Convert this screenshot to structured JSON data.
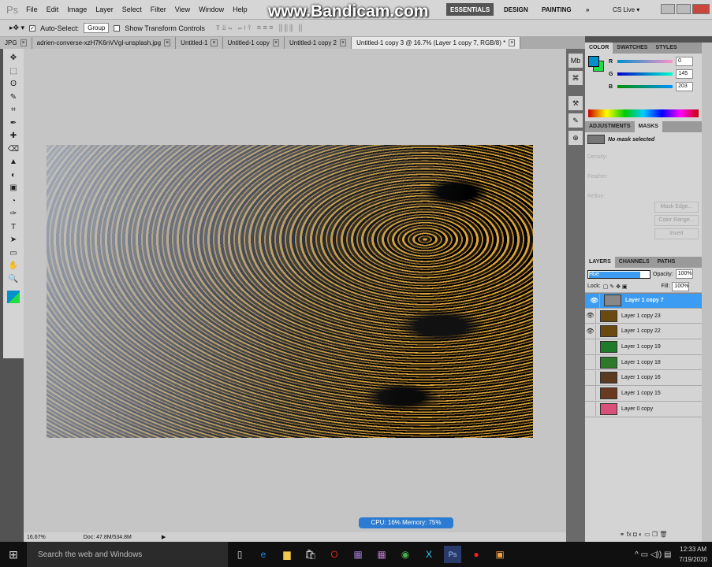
{
  "app": {
    "logo": "Ps",
    "menu": [
      "File",
      "Edit",
      "Image",
      "Layer",
      "Select",
      "Filter",
      "View",
      "Window",
      "Help"
    ],
    "workspaces": [
      "ESSENTIALS",
      "DESIGN",
      "PAINTING"
    ],
    "more": "»",
    "cs_live": "CS Live ▾",
    "watermark": "www.Bandicam.com"
  },
  "options": {
    "auto_select_label": "Auto-Select:",
    "auto_select_value": "Group",
    "show_transform": "Show Transform Controls"
  },
  "tabs": [
    {
      "label": "JPG"
    },
    {
      "label": "adrien-converse-xzH7K6nVVgI-unsplash.jpg"
    },
    {
      "label": "Untitled-1"
    },
    {
      "label": "Untitled-1 copy"
    },
    {
      "label": "Untitled-1 copy 2"
    },
    {
      "label": "Untitled-1 copy 3 @ 16.7% (Layer 1 copy 7, RGB/8) *",
      "active": true
    }
  ],
  "tools": [
    "✥",
    "⬚",
    "ʘ",
    "✎",
    "⌗",
    "✒",
    "✚",
    "⌫",
    "▲",
    "◐",
    "▣",
    "◔",
    "✑",
    "T",
    "➤",
    "▭",
    "✋",
    "🔍"
  ],
  "color_panel": {
    "tabs": [
      "COLOR",
      "SWATCHES",
      "STYLES"
    ],
    "fg": "#0091cb",
    "bg": "#22dd44",
    "channels": [
      {
        "name": "R",
        "value": "0"
      },
      {
        "name": "G",
        "value": "145"
      },
      {
        "name": "B",
        "value": "203"
      }
    ]
  },
  "masks_panel": {
    "tabs": [
      "ADJUSTMENTS",
      "MASKS"
    ],
    "status": "No mask selected",
    "density": "Density:",
    "feather": "Feather:",
    "refine": "Refine:",
    "buttons": [
      "Mask Edge...",
      "Color Range...",
      "Invert"
    ]
  },
  "layers_panel": {
    "tabs": [
      "LAYERS",
      "CHANNELS",
      "PATHS"
    ],
    "blend_mode": "Hue",
    "opacity_label": "Opacity:",
    "opacity": "100%",
    "lock_label": "Lock:",
    "fill_label": "Fill:",
    "fill": "100%",
    "layers": [
      {
        "name": "Layer 1 copy 7",
        "visible": true,
        "selected": true,
        "thumb": "#888"
      },
      {
        "name": "Layer 1 copy 23",
        "visible": true,
        "thumb": "#6a4a10"
      },
      {
        "name": "Layer 1 copy 22",
        "visible": true,
        "thumb": "#6a4a10"
      },
      {
        "name": "Layer 1 copy 19",
        "visible": false,
        "thumb": "#1f7a2a"
      },
      {
        "name": "Layer 1 copy 18",
        "visible": false,
        "thumb": "#2f7a2a"
      },
      {
        "name": "Layer 1 copy 16",
        "visible": false,
        "thumb": "#5a3a20"
      },
      {
        "name": "Layer 1 copy 15",
        "visible": false,
        "thumb": "#6a3a20"
      },
      {
        "name": "Layer 0 copy",
        "visible": false,
        "thumb": "#d9507a"
      }
    ],
    "footer_icons": "⚭ fx ◘ ◐ ▭ ❐ 🗑"
  },
  "status": {
    "zoom": "16.67%",
    "doc": "Doc: 47.8M/534.8M",
    "cpu": "CPU: 16%  Memory: 75%"
  },
  "taskbar": {
    "search": "Search the web and Windows",
    "time": "12:33 AM",
    "date": "7/19/2020"
  }
}
